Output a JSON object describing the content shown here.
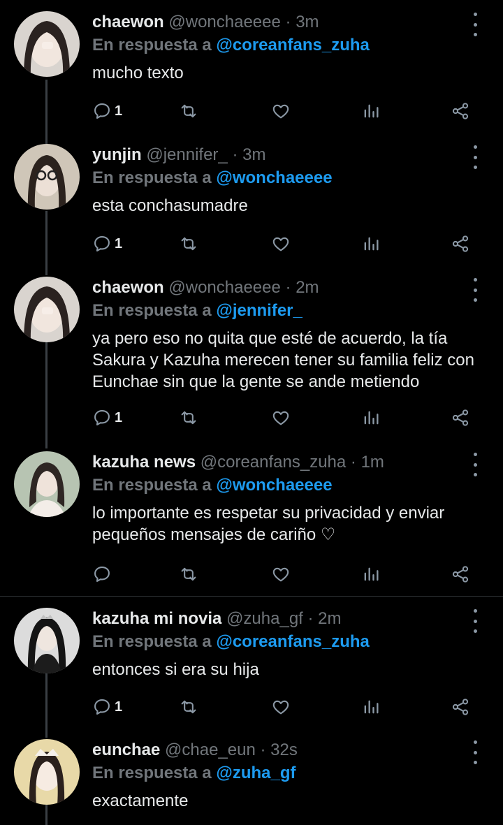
{
  "tweets": [
    {
      "name": "chaewon",
      "handle": "@wonchaeeee",
      "sep": " · ",
      "time": "3m",
      "reply_prefix": "En respuesta a",
      "reply_to": "@coreanfans_zuha",
      "text": "mucho texto",
      "reply_count": "1",
      "icons": [
        "reply-icon",
        "retweet-icon",
        "like-icon",
        "analytics-icon",
        "share-icon"
      ]
    },
    {
      "name": "yunjin",
      "handle": "@jennifer_",
      "sep": " · ",
      "time": "3m",
      "reply_prefix": "En respuesta a",
      "reply_to": "@wonchaeeee",
      "text": "esta conchasumadre",
      "reply_count": "1"
    },
    {
      "name": "chaewon",
      "handle": "@wonchaeeee",
      "sep": " · ",
      "time": "2m",
      "reply_prefix": "En respuesta a",
      "reply_to": "@jennifer_",
      "text": "ya pero eso no quita que esté de acuerdo, la tía Sakura y Kazuha merecen tener su familia feliz con Eunchae sin que la gente se ande metiendo",
      "reply_count": "1"
    },
    {
      "name": "kazuha news",
      "handle": "@coreanfans_zuha",
      "sep": " · ",
      "time": "1m",
      "reply_prefix": "En respuesta a",
      "reply_to": "@wonchaeeee",
      "text": "lo importante es respetar su privacidad y enviar pequeños mensajes de cariño ♡",
      "reply_count": ""
    },
    {
      "name": "kazuha mi novia",
      "handle": "@zuha_gf",
      "sep": " · ",
      "time": "2m",
      "reply_prefix": "En respuesta a",
      "reply_to": "@coreanfans_zuha",
      "text": "entonces si era su hija",
      "reply_count": "1"
    },
    {
      "name": "eunchae",
      "handle": "@chae_eun",
      "sep": " · ",
      "time": "32s",
      "reply_prefix": "En respuesta a",
      "reply_to": "@zuha_gf",
      "text": "exactamente",
      "reply_count": ""
    }
  ],
  "colors": {
    "background": "#000000",
    "text": "#e7e9ea",
    "secondary": "#71767b",
    "mention": "#1d9bf0",
    "thread_line": "#3a3f44"
  }
}
